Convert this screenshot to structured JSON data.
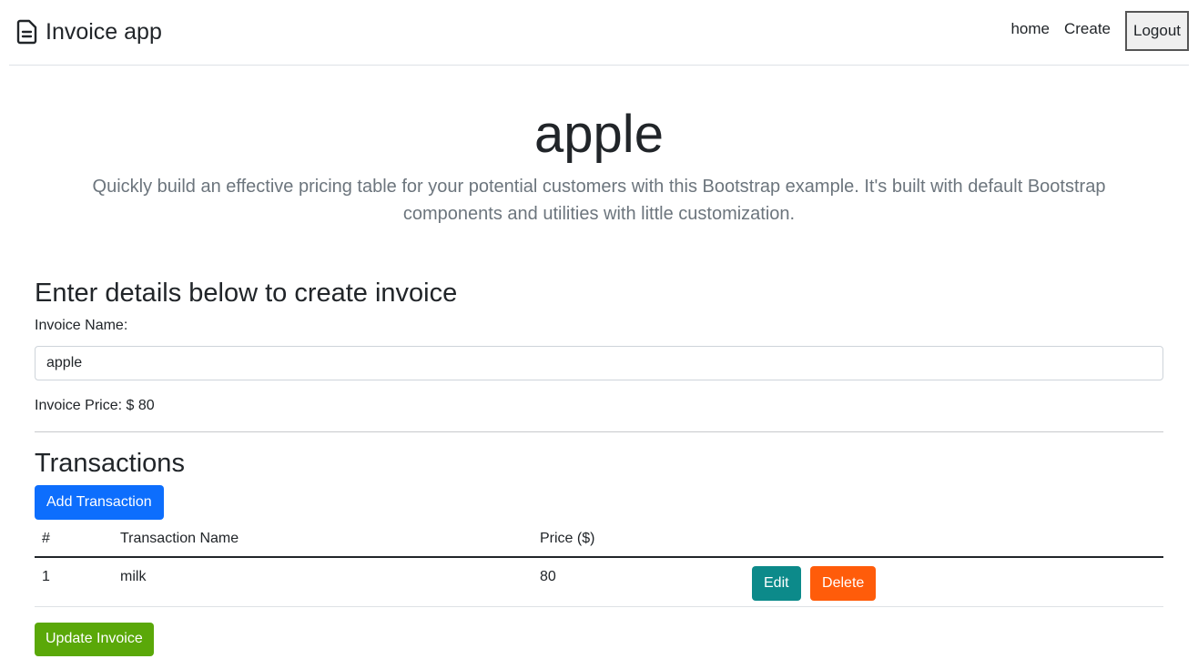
{
  "navbar": {
    "brand": "Invoice app",
    "brand_icon": "file-text-icon",
    "links": [
      "home",
      "Create"
    ],
    "logout": "Logout"
  },
  "hero": {
    "title": "apple",
    "lead": "Quickly build an effective pricing table for your potential customers with this Bootstrap example. It's built with default Bootstrap components and utilities with little customization."
  },
  "form": {
    "heading": "Enter details below to create invoice",
    "name_label": "Invoice Name:",
    "name_value": "apple",
    "price_line": "Invoice Price: $ 80"
  },
  "transactions": {
    "heading": "Transactions",
    "add_button": "Add Transaction",
    "columns": [
      "#",
      "Transaction Name",
      "Price ($)",
      ""
    ],
    "rows": [
      {
        "num": "1",
        "name": "milk",
        "price": "80",
        "edit": "Edit",
        "delete": "Delete"
      }
    ]
  },
  "update_button": "Update Invoice",
  "colors": {
    "primary": "#0d6efd",
    "edit": "#0c8a8a",
    "delete": "#ff5c0a",
    "update": "#5aa809",
    "muted_text": "#6c757d"
  }
}
